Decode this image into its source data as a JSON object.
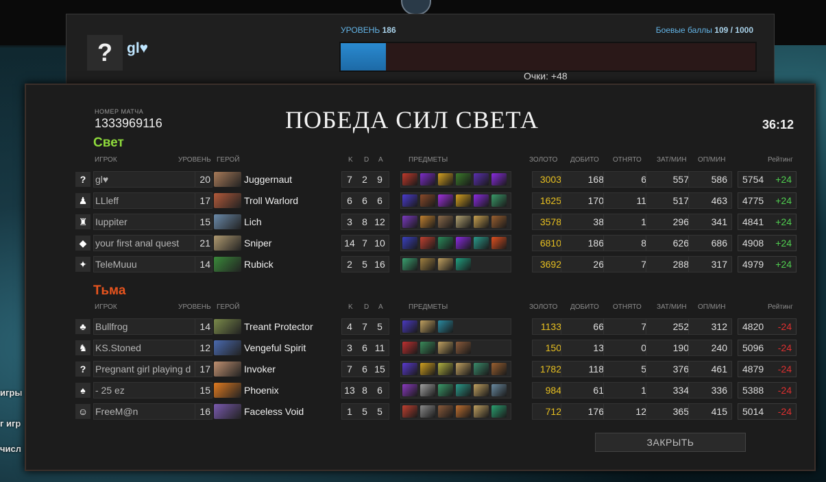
{
  "top": {
    "player_name": "gl♥",
    "avatar_glyph": "?",
    "level_label": "УРОВЕНЬ",
    "level_value": "186",
    "battle_points_label": "Боевые баллы",
    "battle_points_value": "109 / 1000",
    "battle_points_progress": 0.109,
    "points_text": "Очки: +48"
  },
  "side_texts": [
    "игры",
    "г игр",
    "числ"
  ],
  "match": {
    "label": "НОМЕР МАТЧА",
    "id": "1333969116",
    "title": "ПОБЕДА СИЛ СВЕТА",
    "duration": "36:12",
    "close_label": "ЗАКРЫТЬ"
  },
  "headers": {
    "player": "ИГРОК",
    "level": "УРОВЕНЬ",
    "hero": "ГЕРОЙ",
    "k": "K",
    "d": "D",
    "a": "A",
    "items": "ПРЕДМЕТЫ",
    "gold": "ЗОЛОТО",
    "last_hits": "ДОБИТО",
    "denies": "ОТНЯТО",
    "xpm": "ЗАТ/МИН",
    "gpm": "ОП/МИН",
    "rating": "Рейтинг"
  },
  "radiant": {
    "name": "Свет",
    "players": [
      {
        "avatar": "?",
        "name": "gl♥",
        "level": "20",
        "hero": "Juggernaut",
        "k": "7",
        "d": "2",
        "a": "9",
        "gold": "3003",
        "lh": "168",
        "dn": "6",
        "xpm": "557",
        "gpm": "586",
        "rating": "5754",
        "delta": "+24",
        "items": [
          "#c0392b",
          "#7d2cc9",
          "#d4a020",
          "#3a7a2a",
          "#5a2fb0",
          "#8a2be2"
        ],
        "hero_color": "#a87a58"
      },
      {
        "avatar": "♟",
        "name": "LLleff",
        "level": "17",
        "hero": "Troll Warlord",
        "k": "6",
        "d": "6",
        "a": "6",
        "gold": "1625",
        "lh": "170",
        "dn": "11",
        "xpm": "517",
        "gpm": "463",
        "rating": "4775",
        "delta": "+24",
        "items": [
          "#4a3bd0",
          "#8a4a2a",
          "#a030e0",
          "#d4a020",
          "#8a2be2",
          "#3a9a6a"
        ],
        "hero_color": "#b45a3a"
      },
      {
        "avatar": "♜",
        "name": "Iuppiter",
        "level": "15",
        "hero": "Lich",
        "k": "3",
        "d": "8",
        "a": "12",
        "gold": "3578",
        "lh": "38",
        "dn": "1",
        "xpm": "296",
        "gpm": "341",
        "rating": "4841",
        "delta": "+24",
        "items": [
          "#7a3ac0",
          "#c08030",
          "#8a6a4a",
          "#b0a070",
          "#c8a050",
          "#9a6030"
        ],
        "hero_color": "#6a8aaa"
      },
      {
        "avatar": "◆",
        "name": "your first anal quest",
        "level": "21",
        "hero": "Sniper",
        "k": "14",
        "d": "7",
        "a": "10",
        "gold": "6810",
        "lh": "186",
        "dn": "8",
        "xpm": "626",
        "gpm": "686",
        "rating": "4908",
        "delta": "+24",
        "items": [
          "#3a40c0",
          "#c04030",
          "#2a8a5a",
          "#8a2be2",
          "#2a9a8a",
          "#e05020"
        ],
        "hero_color": "#b09a70"
      },
      {
        "avatar": "✦",
        "name": "TeleMuuu",
        "level": "14",
        "hero": "Rubick",
        "k": "2",
        "d": "5",
        "a": "16",
        "gold": "3692",
        "lh": "26",
        "dn": "7",
        "xpm": "288",
        "gpm": "317",
        "rating": "4979",
        "delta": "+24",
        "items": [
          "#3aa070",
          "#a08040",
          "#c0a060",
          "#20a080"
        ],
        "hero_color": "#3a8a3a"
      }
    ]
  },
  "dire": {
    "name": "Тьма",
    "players": [
      {
        "avatar": "♣",
        "name": "Bullfrog",
        "level": "14",
        "hero": "Treant Protector",
        "k": "4",
        "d": "7",
        "a": "5",
        "gold": "1133",
        "lh": "66",
        "dn": "7",
        "xpm": "252",
        "gpm": "312",
        "rating": "4820",
        "delta": "-24",
        "items": [
          "#4a3ac0",
          "#c0a060",
          "#2a8aa0"
        ],
        "hero_color": "#7a8a4a"
      },
      {
        "avatar": "♞",
        "name": "KS.Stoned",
        "level": "12",
        "hero": "Vengeful Spirit",
        "k": "3",
        "d": "6",
        "a": "11",
        "gold": "150",
        "lh": "13",
        "dn": "0",
        "xpm": "190",
        "gpm": "240",
        "rating": "5096",
        "delta": "-24",
        "items": [
          "#c03030",
          "#3a8a5a",
          "#c0a060",
          "#8a5a3a"
        ],
        "hero_color": "#4a6ab0"
      },
      {
        "avatar": "?",
        "name": "Pregnant girl playing d",
        "level": "17",
        "hero": "Invoker",
        "k": "7",
        "d": "6",
        "a": "15",
        "gold": "1782",
        "lh": "118",
        "dn": "5",
        "xpm": "376",
        "gpm": "461",
        "rating": "4879",
        "delta": "-24",
        "items": [
          "#5a3ad0",
          "#d0a020",
          "#b0b040",
          "#c0a060",
          "#3a8a6a",
          "#9a6030"
        ],
        "hero_color": "#c09070"
      },
      {
        "avatar": "♠",
        "name": "- 25 ez",
        "level": "15",
        "hero": "Phoenix",
        "k": "13",
        "d": "8",
        "a": "6",
        "gold": "984",
        "lh": "61",
        "dn": "1",
        "xpm": "334",
        "gpm": "336",
        "rating": "5388",
        "delta": "-24",
        "items": [
          "#8a3ac0",
          "#a0a0a0",
          "#3a9a6a",
          "#2a9a8a",
          "#c0a060",
          "#6a8aa0"
        ],
        "hero_color": "#e07a20"
      },
      {
        "avatar": "☺",
        "name": "FreeM@n",
        "level": "16",
        "hero": "Faceless Void",
        "k": "1",
        "d": "5",
        "a": "5",
        "gold": "712",
        "lh": "176",
        "dn": "12",
        "xpm": "365",
        "gpm": "415",
        "rating": "5014",
        "delta": "-24",
        "items": [
          "#c04030",
          "#8a8a8a",
          "#8a5a3a",
          "#c07030",
          "#c0a060",
          "#2aa070"
        ],
        "hero_color": "#7a5ab0"
      }
    ]
  }
}
